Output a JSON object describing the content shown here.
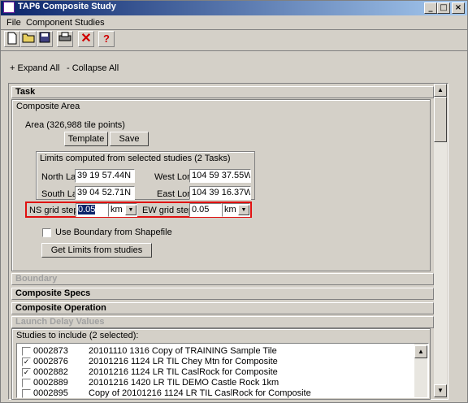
{
  "window": {
    "title": "TAP6 Composite Study"
  },
  "menu": [
    "File",
    "Component Studies"
  ],
  "links": {
    "expand": "+ Expand All",
    "collapse": "- Collapse All"
  },
  "task": {
    "header": "Task",
    "area_title": "Composite Area",
    "area_info": "Area (326,988 tile points)",
    "template_label": "Template",
    "save_label": "Save",
    "limits_title": "Limits computed from selected studies (2 Tasks)",
    "north_lat_label": "North Lat",
    "north_lat": "39 19 57.44N",
    "west_lon_label": "West Lon",
    "west_lon": "104 59 37.55W",
    "south_lat_label": "South Lat",
    "south_lat": "39 04 52.71N",
    "east_lon_label": "East Lon",
    "east_lon": "104 39 16.37W",
    "ns_label": "NS grid step:",
    "ns_value": "0.05",
    "ns_unit": "km",
    "ew_label": "EW grid step:",
    "ew_value": "0.05",
    "ew_unit": "km",
    "boundary_label": "Use Boundary from Shapefile",
    "get_limits_label": "Get Limits from studies"
  },
  "sections": {
    "boundary": "Boundary",
    "specs": "Composite Specs",
    "operation": "Composite Operation",
    "launch": "Launch Delay Values"
  },
  "studies": {
    "label": "Studies to include (2 selected):",
    "rows": [
      {
        "id": "0002873",
        "name": "20101110 1316 Copy of TRAINING Sample Tile",
        "checked": false
      },
      {
        "id": "0002876",
        "name": "20101216 1124 LR TIL Chey Mtn for Composite",
        "checked": true
      },
      {
        "id": "0002882",
        "name": "20101216 1124 LR TIL CaslRock for Composite",
        "checked": true
      },
      {
        "id": "0002889",
        "name": "20101216 1420 LR TIL DEMO Castle Rock 1km",
        "checked": false
      },
      {
        "id": "0002895",
        "name": "Copy of 20101216 1124 LR TIL CaslRock for Composite",
        "checked": false
      }
    ]
  }
}
